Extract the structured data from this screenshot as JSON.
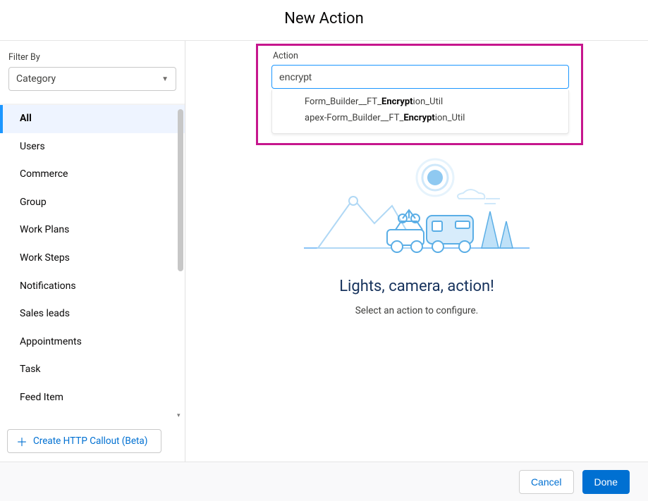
{
  "title": "New Action",
  "sidebar": {
    "filter_label": "Filter By",
    "filter_value": "Category",
    "items": [
      {
        "label": "All",
        "active": true
      },
      {
        "label": "Users",
        "active": false
      },
      {
        "label": "Commerce",
        "active": false
      },
      {
        "label": "Group",
        "active": false
      },
      {
        "label": "Work Plans",
        "active": false
      },
      {
        "label": "Work Steps",
        "active": false
      },
      {
        "label": "Notifications",
        "active": false
      },
      {
        "label": "Sales leads",
        "active": false
      },
      {
        "label": "Appointments",
        "active": false
      },
      {
        "label": "Task",
        "active": false
      },
      {
        "label": "Feed Item",
        "active": false
      }
    ],
    "http_button_label": "Create HTTP Callout (Beta)"
  },
  "main": {
    "action_label": "Action",
    "search_value": "encrypt",
    "suggestions": [
      {
        "prefix": "Form_Builder__FT_",
        "match": "Encrypt",
        "suffix": "ion_Util"
      },
      {
        "prefix": "apex-Form_Builder__FT_",
        "match": "Encrypt",
        "suffix": "ion_Util"
      }
    ],
    "hero_title": "Lights, camera, action!",
    "hero_sub": "Select an action to configure."
  },
  "footer": {
    "cancel": "Cancel",
    "done": "Done"
  },
  "colors": {
    "highlight": "#c6168d",
    "primary": "#0070d2",
    "focus": "#1b96ff"
  }
}
